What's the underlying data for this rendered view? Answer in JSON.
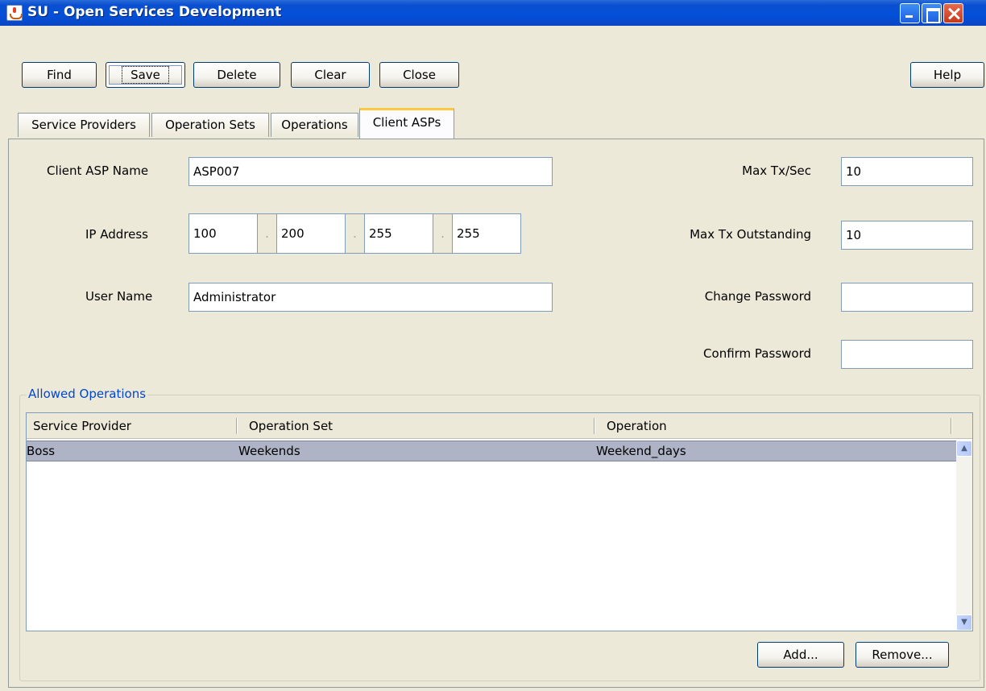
{
  "window": {
    "title": "SU - Open Services Development"
  },
  "toolbar": {
    "find": "Find",
    "save": "Save",
    "delete": "Delete",
    "clear": "Clear",
    "close": "Close",
    "help": "Help"
  },
  "tabs": [
    {
      "label": "Service Providers",
      "active": false
    },
    {
      "label": "Operation Sets",
      "active": false
    },
    {
      "label": "Operations",
      "active": false
    },
    {
      "label": "Client ASPs",
      "active": true
    }
  ],
  "form": {
    "client_asp_name": {
      "label": "Client ASP Name",
      "value": "ASP007"
    },
    "ip_address": {
      "label": "IP Address",
      "octets": [
        "100",
        "200",
        "255",
        "255"
      ],
      "separator": "."
    },
    "user_name": {
      "label": "User Name",
      "value": "Administrator"
    },
    "max_tx_sec": {
      "label": "Max Tx/Sec",
      "value": "10"
    },
    "max_tx_outstanding": {
      "label": "Max Tx Outstanding",
      "value": "10"
    },
    "change_password": {
      "label": "Change Password",
      "value": ""
    },
    "confirm_password": {
      "label": "Confirm Password",
      "value": ""
    }
  },
  "allowed_operations": {
    "title": "Allowed Operations",
    "columns": [
      "Service Provider",
      "Operation Set",
      "Operation"
    ],
    "rows": [
      {
        "service_provider": "Boss",
        "operation_set": "Weekends",
        "operation": "Weekend_days",
        "selected": true
      }
    ],
    "add_button": "Add...",
    "remove_button": "Remove..."
  },
  "colors": {
    "titlebar": "#0350d9",
    "active_tab_accent": "#ffc83c",
    "group_title": "#0046d5",
    "selected_row": "#aeb3c6"
  }
}
